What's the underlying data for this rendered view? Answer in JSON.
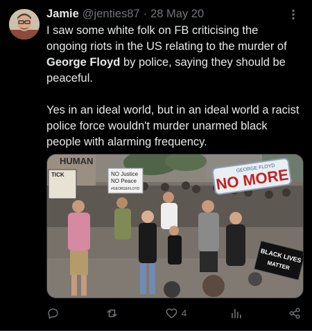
{
  "tweet": {
    "author_name": "Jamie",
    "handle": "@jenties87",
    "separator": "·",
    "date": "28 May 20",
    "text_para1_before": "I saw some white folk on FB criticising the ongoing riots in the US relating to the murder of ",
    "text_para1_bold": "George Floyd",
    "text_para1_after": " by police, saying they should be peaceful.",
    "text_para2": "Yes in an ideal world, but in an ideal world a racist police force wouldn't murder unarmed black people with alarming frequency."
  },
  "media": {
    "signs": {
      "no_more": "NO MORE",
      "george_floyd_small": "GEORGE FLOYD",
      "no_justice_line1": "NO Justice",
      "no_justice_line2": "NO Peace",
      "no_justice_line3": "#GEORGEFLOYD",
      "black_lives_line1": "BLACK LIVES",
      "black_lives_line2": "MATTER",
      "left_sign": "TICK",
      "top_left": "HUMAN"
    }
  },
  "actions": {
    "reply_count": "",
    "retweet_count": "",
    "like_count": "4",
    "views_count": ""
  },
  "colors": {
    "background": "#000000",
    "text_primary": "#e7e9ea",
    "text_secondary": "#71767b",
    "no_more_red": "#c42020"
  },
  "icons": [
    "avatar",
    "more-icon",
    "reply-icon",
    "retweet-icon",
    "like-icon",
    "views-icon",
    "share-icon"
  ]
}
